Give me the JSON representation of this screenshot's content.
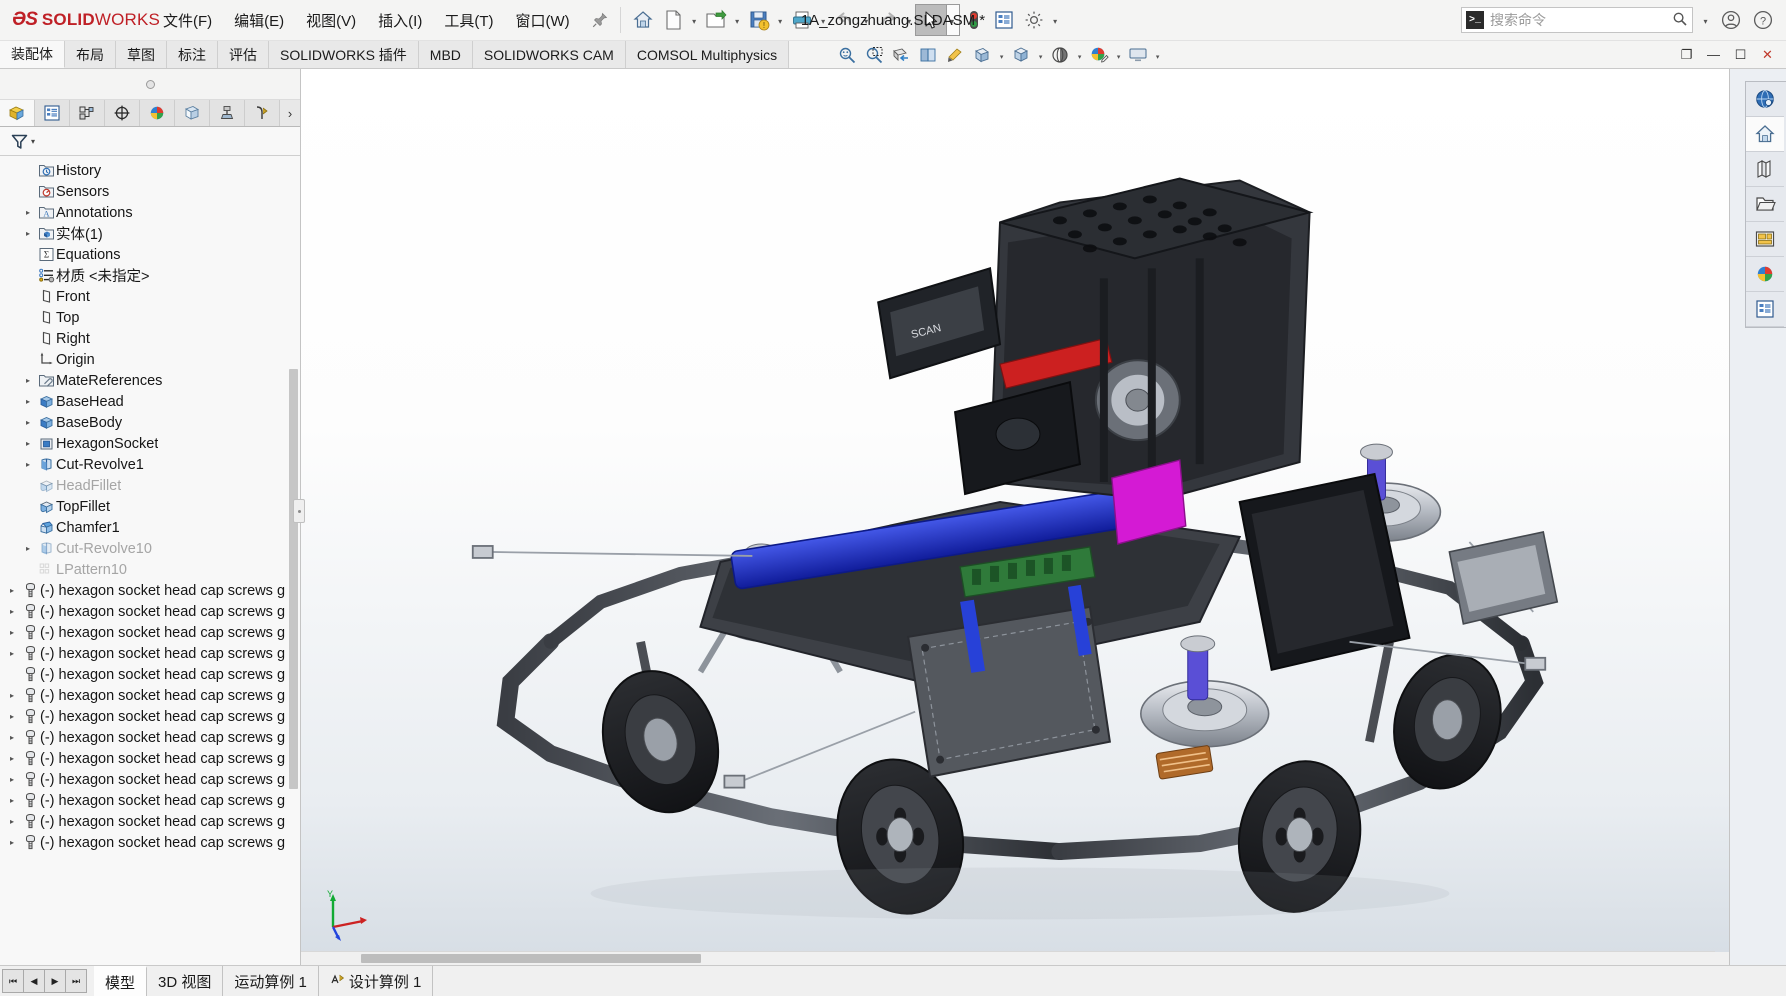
{
  "app": {
    "brand_ds": "ℰS",
    "brand_solid": "SOLID",
    "brand_works": "WORKS",
    "document_title": "1A_zongzhuang.SLDASM *"
  },
  "menu": {
    "items": [
      {
        "label": "文件(F)",
        "name": "menu-file"
      },
      {
        "label": "编辑(E)",
        "name": "menu-edit"
      },
      {
        "label": "视图(V)",
        "name": "menu-view"
      },
      {
        "label": "插入(I)",
        "name": "menu-insert"
      },
      {
        "label": "工具(T)",
        "name": "menu-tools"
      },
      {
        "label": "窗口(W)",
        "name": "menu-window"
      }
    ],
    "pin_icon": "pushpin-icon"
  },
  "quickbar": {
    "buttons": [
      {
        "name": "home-button",
        "icon": "home-icon",
        "caret": false
      },
      {
        "name": "new-document-button",
        "icon": "new-document-icon",
        "caret": true
      },
      {
        "name": "open-document-button",
        "icon": "open-folder-icon",
        "caret": true
      },
      {
        "name": "save-button",
        "icon": "save-floppy-icon",
        "caret": true
      },
      {
        "name": "print-button",
        "icon": "printer-icon",
        "caret": true
      },
      {
        "name": "undo-button",
        "icon": "undo-arrow-icon",
        "caret": true
      },
      {
        "name": "redo-button",
        "icon": "redo-arrow-icon",
        "caret": true
      },
      {
        "name": "select-button",
        "icon": "cursor-arrow-icon",
        "caret": true
      },
      {
        "name": "rebuild-button",
        "icon": "traffic-light-icon",
        "caret": false
      },
      {
        "name": "file-properties-button",
        "icon": "properties-list-icon",
        "caret": false
      },
      {
        "name": "options-button",
        "icon": "gear-icon",
        "caret": true
      }
    ]
  },
  "search": {
    "placeholder": "搜索命令",
    "glyph": ">_",
    "magnifier": "search-icon"
  },
  "title_right": {
    "account_icon": "user-account-icon",
    "help_icon": "help-question-icon"
  },
  "command_tabs": [
    {
      "label": "装配体",
      "name": "tab-assembly",
      "active": true
    },
    {
      "label": "布局",
      "name": "tab-layout",
      "active": false
    },
    {
      "label": "草图",
      "name": "tab-sketch",
      "active": false
    },
    {
      "label": "标注",
      "name": "tab-markup",
      "active": false
    },
    {
      "label": "评估",
      "name": "tab-evaluate",
      "active": false
    },
    {
      "label": "SOLIDWORKS 插件",
      "name": "tab-solidworks-addins",
      "active": false
    },
    {
      "label": "MBD",
      "name": "tab-mbd",
      "active": false
    },
    {
      "label": "SOLIDWORKS CAM",
      "name": "tab-solidworks-cam",
      "active": false
    },
    {
      "label": "COMSOL Multiphysics",
      "name": "tab-comsol-multiphysics",
      "active": false
    }
  ],
  "view_tools": [
    {
      "name": "zoom-to-fit-button",
      "icon": "zoom-fit-icon",
      "caret": false
    },
    {
      "name": "zoom-to-area-button",
      "icon": "zoom-area-icon",
      "caret": false
    },
    {
      "name": "section-view-button",
      "icon": "section-view-icon",
      "caret": false
    },
    {
      "name": "view-orientation-button",
      "icon": "view-orientation-icon",
      "caret": false
    },
    {
      "name": "display-style-button",
      "icon": "display-style-icon",
      "caret": false
    },
    {
      "name": "hide-show-items-button",
      "icon": "hide-show-icon",
      "caret": true
    },
    {
      "name": "edit-appearance-button",
      "icon": "appearance-cube-icon",
      "caret": true
    },
    {
      "name": "apply-scene-button",
      "icon": "scene-icon",
      "caret": true
    },
    {
      "name": "view-settings-button",
      "icon": "palette-icon",
      "caret": true
    },
    {
      "name": "viewport-button",
      "icon": "viewport-icon",
      "caret": true
    }
  ],
  "window_controls": {
    "restore_doc": "❐",
    "minimize": "—",
    "maximize": "☐",
    "close": "✕"
  },
  "feature_manager": {
    "tabs": [
      {
        "name": "feature-tree-tab",
        "icon": "feature-tree-icon",
        "active": true
      },
      {
        "name": "property-manager-tab",
        "icon": "property-manager-icon",
        "active": false
      },
      {
        "name": "configuration-manager-tab",
        "icon": "configuration-manager-icon",
        "active": false
      },
      {
        "name": "dimxpert-manager-tab",
        "icon": "dimxpert-icon",
        "active": false
      },
      {
        "name": "display-manager-tab",
        "icon": "display-manager-icon",
        "active": false
      },
      {
        "name": "cam-feature-tree-tab",
        "icon": "cam-feature-icon",
        "active": false
      },
      {
        "name": "cam-operation-tree-tab",
        "icon": "cam-operation-icon",
        "active": false
      },
      {
        "name": "cam-tools-tab",
        "icon": "cam-tools-icon",
        "active": false
      }
    ],
    "more_tabs_glyph": "›",
    "filter_icon": "filter-funnel-icon",
    "filter_caret": "▾",
    "tree": [
      {
        "label": "History",
        "icon": "history-folder-icon",
        "arrow": false,
        "indent": 1,
        "dim": false
      },
      {
        "label": "Sensors",
        "icon": "sensors-folder-icon",
        "arrow": false,
        "indent": 1,
        "dim": false
      },
      {
        "label": "Annotations",
        "icon": "annotations-folder-icon",
        "arrow": true,
        "indent": 1,
        "dim": false
      },
      {
        "label": "实体(1)",
        "icon": "solid-bodies-folder-icon",
        "arrow": true,
        "indent": 1,
        "dim": false
      },
      {
        "label": "Equations",
        "icon": "equations-icon",
        "arrow": false,
        "indent": 1,
        "dim": false
      },
      {
        "label": "材质 <未指定>",
        "icon": "material-icon",
        "arrow": false,
        "indent": 1,
        "dim": false
      },
      {
        "label": "Front",
        "icon": "plane-icon",
        "arrow": false,
        "indent": 1,
        "dim": false
      },
      {
        "label": "Top",
        "icon": "plane-icon",
        "arrow": false,
        "indent": 1,
        "dim": false
      },
      {
        "label": "Right",
        "icon": "plane-icon",
        "arrow": false,
        "indent": 1,
        "dim": false
      },
      {
        "label": "Origin",
        "icon": "origin-icon",
        "arrow": false,
        "indent": 1,
        "dim": false
      },
      {
        "label": "MateReferences",
        "icon": "mate-references-icon",
        "arrow": true,
        "indent": 1,
        "dim": false
      },
      {
        "label": "BaseHead",
        "icon": "boss-extrude-icon",
        "arrow": true,
        "indent": 1,
        "dim": false
      },
      {
        "label": "BaseBody",
        "icon": "boss-extrude-icon",
        "arrow": true,
        "indent": 1,
        "dim": false
      },
      {
        "label": "HexagonSocket",
        "icon": "cut-extrude-icon",
        "arrow": true,
        "indent": 1,
        "dim": false
      },
      {
        "label": "Cut-Revolve1",
        "icon": "cut-revolve-icon",
        "arrow": true,
        "indent": 1,
        "dim": false
      },
      {
        "label": "HeadFillet",
        "icon": "fillet-icon",
        "arrow": false,
        "indent": 1,
        "dim": true
      },
      {
        "label": "TopFillet",
        "icon": "fillet-icon",
        "arrow": false,
        "indent": 1,
        "dim": false
      },
      {
        "label": "Chamfer1",
        "icon": "chamfer-icon",
        "arrow": false,
        "indent": 1,
        "dim": false
      },
      {
        "label": "Cut-Revolve10",
        "icon": "cut-revolve-icon",
        "arrow": true,
        "indent": 1,
        "dim": true
      },
      {
        "label": "LPattern10",
        "icon": "linear-pattern-icon",
        "arrow": false,
        "indent": 1,
        "dim": true
      },
      {
        "label": "(-) hexagon socket head cap screws g",
        "icon": "component-screw-icon",
        "arrow": true,
        "indent": 0,
        "dim": false
      },
      {
        "label": "(-) hexagon socket head cap screws g",
        "icon": "component-screw-icon",
        "arrow": true,
        "indent": 0,
        "dim": false
      },
      {
        "label": "(-) hexagon socket head cap screws g",
        "icon": "component-screw-icon",
        "arrow": true,
        "indent": 0,
        "dim": false
      },
      {
        "label": "(-) hexagon socket head cap screws g",
        "icon": "component-screw-icon",
        "arrow": true,
        "indent": 0,
        "dim": false
      },
      {
        "label": "(-) hexagon socket head cap screws g",
        "icon": "component-screw-icon",
        "arrow": false,
        "indent": 0,
        "dim": false
      },
      {
        "label": "(-) hexagon socket head cap screws g",
        "icon": "component-screw-icon",
        "arrow": true,
        "indent": 0,
        "dim": false
      },
      {
        "label": "(-) hexagon socket head cap screws g",
        "icon": "component-screw-icon",
        "arrow": true,
        "indent": 0,
        "dim": false
      },
      {
        "label": "(-) hexagon socket head cap screws g",
        "icon": "component-screw-icon",
        "arrow": true,
        "indent": 0,
        "dim": false
      },
      {
        "label": "(-) hexagon socket head cap screws g",
        "icon": "component-screw-icon",
        "arrow": true,
        "indent": 0,
        "dim": false
      },
      {
        "label": "(-) hexagon socket head cap screws g",
        "icon": "component-screw-icon",
        "arrow": true,
        "indent": 0,
        "dim": false
      },
      {
        "label": "(-) hexagon socket head cap screws g",
        "icon": "component-screw-icon",
        "arrow": true,
        "indent": 0,
        "dim": false
      },
      {
        "label": "(-) hexagon socket head cap screws g",
        "icon": "component-screw-icon",
        "arrow": true,
        "indent": 0,
        "dim": false
      },
      {
        "label": "(-) hexagon socket head cap screws g",
        "icon": "component-screw-icon",
        "arrow": true,
        "indent": 0,
        "dim": false
      }
    ]
  },
  "task_pane": [
    {
      "name": "task-pane-resources",
      "icon": "solidworks-resources-icon",
      "active": false
    },
    {
      "name": "task-pane-design-library",
      "icon": "home-icon",
      "active": true
    },
    {
      "name": "task-pane-library",
      "icon": "design-library-books-icon",
      "active": false
    },
    {
      "name": "task-pane-file-explorer",
      "icon": "folder-icon",
      "active": false
    },
    {
      "name": "task-pane-view-palette",
      "icon": "view-palette-icon",
      "active": false
    },
    {
      "name": "task-pane-appearances",
      "icon": "appearances-ball-icon",
      "active": false
    },
    {
      "name": "task-pane-custom-properties",
      "icon": "custom-properties-icon",
      "active": false
    }
  ],
  "bottom": {
    "nav": [
      {
        "name": "tab-first-button",
        "glyph": "⏮"
      },
      {
        "name": "tab-prev-button",
        "glyph": "◀"
      },
      {
        "name": "tab-next-button",
        "glyph": "▶"
      },
      {
        "name": "tab-last-button",
        "glyph": "⏭"
      }
    ],
    "tabs": [
      {
        "label": "模型",
        "name": "bottom-tab-model",
        "active": true,
        "icon": null
      },
      {
        "label": "3D 视图",
        "name": "bottom-tab-3d-views",
        "active": false,
        "icon": null
      },
      {
        "label": "运动算例 1",
        "name": "bottom-tab-motion-study-1",
        "active": false,
        "icon": null
      },
      {
        "label": "设计算例 1",
        "name": "bottom-tab-design-study-1",
        "active": false,
        "icon": "design-study-icon"
      }
    ]
  },
  "colors": {
    "brand_red": "#bf2026",
    "accent_blue": "#2f6fb5",
    "model_blue": "#1f3fd0",
    "model_magenta": "#d41ad4",
    "model_red": "#cc2020",
    "model_green": "#2f8f3f"
  }
}
